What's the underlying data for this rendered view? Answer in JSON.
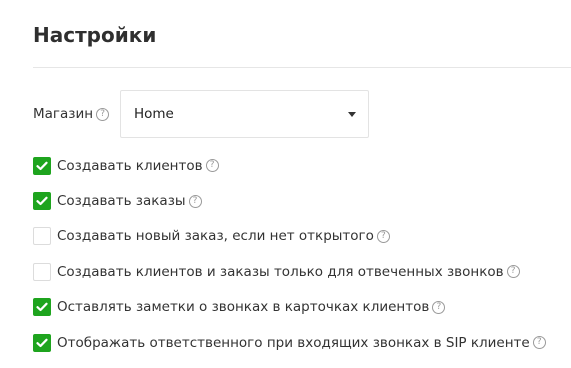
{
  "header": {
    "title": "Настройки"
  },
  "store": {
    "label": "Магазин",
    "help_glyph": "?",
    "selected_value": "Home"
  },
  "options": [
    {
      "label": "Создавать клиентов",
      "checked": true
    },
    {
      "label": "Создавать заказы",
      "checked": true
    },
    {
      "label": "Создавать новый заказ, если нет открытого",
      "checked": false
    },
    {
      "label": "Создавать клиентов и заказы только для отвеченных звонков",
      "checked": false
    },
    {
      "label": "Оставлять заметки о звонках в карточках клиентов",
      "checked": true
    },
    {
      "label": "Отображать ответственного при входящих звонках в SIP клиенте",
      "checked": true
    }
  ],
  "colors": {
    "checkbox_checked": "#1ea41e",
    "help_icon": "#9a9a9a"
  }
}
